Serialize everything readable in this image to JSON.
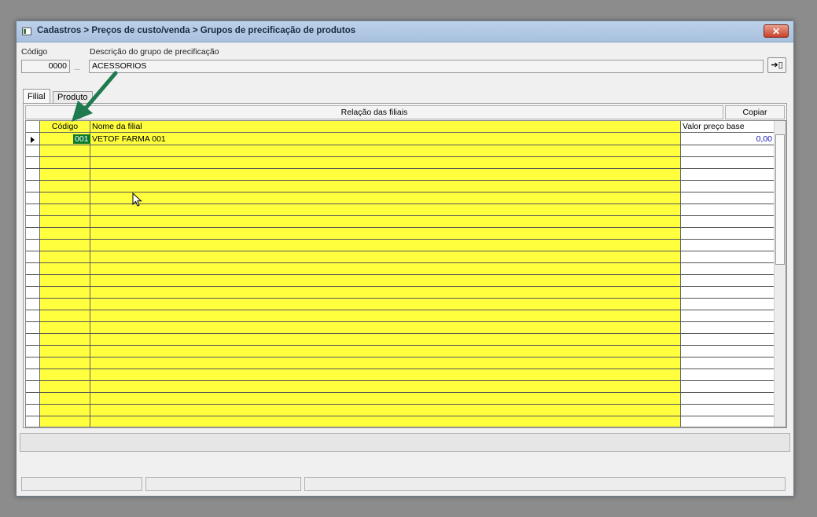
{
  "window": {
    "title": "Cadastros > Preços de custo/venda > Grupos de precificação de produtos",
    "close_label": "✕"
  },
  "header": {
    "codigo_label": "Código",
    "codigo_value": "0000",
    "dots_label": "...",
    "descricao_label": "Descrição do grupo de precificação",
    "descricao_value": "ACESSORIOS",
    "exit_icon": "exit-icon"
  },
  "tabs": [
    {
      "label": "Filial",
      "active": true
    },
    {
      "label": "Produto",
      "active": false
    }
  ],
  "branches": {
    "group_header": "Relação das filiais",
    "copy_label": "Copiar",
    "columns": [
      "Código",
      "Nome da filial",
      "Valor preço base"
    ],
    "rows": [
      {
        "codigo": "001",
        "nome": "VETOF FARMA 001",
        "valor": "0,00"
      }
    ]
  },
  "colors": {
    "highlight_yellow": "#ffff3d",
    "selection_green": "#0b7a2e",
    "value_blue": "#1515b8",
    "annotation_arrow": "#1f7a4f"
  }
}
